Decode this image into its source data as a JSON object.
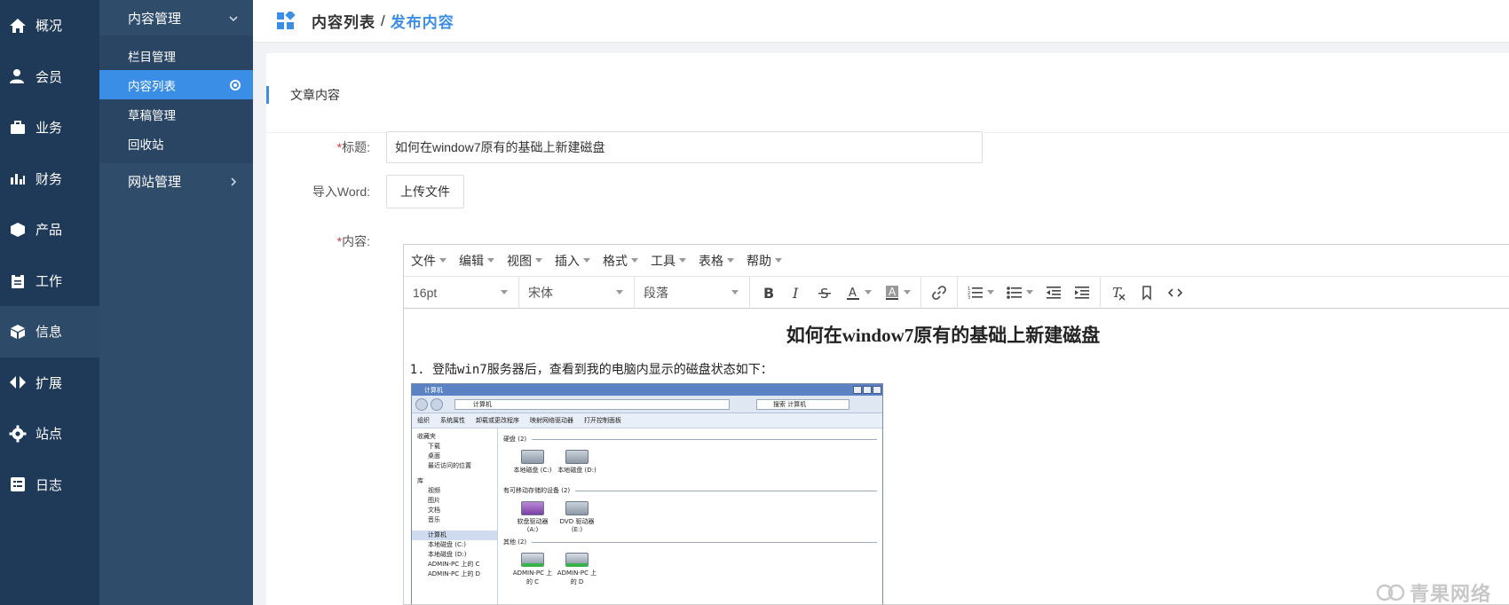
{
  "nav_main": [
    {
      "label": "概况",
      "icon": "home-icon"
    },
    {
      "label": "会员",
      "icon": "user-icon"
    },
    {
      "label": "业务",
      "icon": "briefcase-icon"
    },
    {
      "label": "财务",
      "icon": "bar-chart-icon"
    },
    {
      "label": "产品",
      "icon": "package-icon"
    },
    {
      "label": "工作",
      "icon": "clipboard-icon"
    },
    {
      "label": "信息",
      "icon": "cube-icon",
      "active": true
    },
    {
      "label": "扩展",
      "icon": "code-arrows-icon"
    },
    {
      "label": "站点",
      "icon": "gear-icon"
    },
    {
      "label": "日志",
      "icon": "log-icon"
    }
  ],
  "nav_sub": {
    "group1": "内容管理",
    "items": [
      "栏目管理",
      "内容列表",
      "草稿管理",
      "回收站"
    ],
    "active_item": "内容列表",
    "group2": "网站管理"
  },
  "header": {
    "crumb1": "内容列表",
    "separator": "/",
    "crumb2": "发布内容"
  },
  "card": {
    "title": "文章内容"
  },
  "form": {
    "required_mark": "*",
    "title_label": "标题:",
    "title_value": "如何在window7原有的基础上新建磁盘",
    "import_label": "导入Word:",
    "upload_button": "上传文件",
    "content_label": "内容:"
  },
  "editor": {
    "menus": [
      "文件",
      "编辑",
      "视图",
      "插入",
      "格式",
      "工具",
      "表格",
      "帮助"
    ],
    "font_size": "16pt",
    "font_family": "宋体",
    "block_format": "段落",
    "heading": "如何在window7原有的基础上新建磁盘",
    "list_item_1": "登陆win7服务器后，查看到我的电脑内显示的磁盘状态如下："
  },
  "screenshot": {
    "window_title": "计算机",
    "address": "计算机",
    "search": "搜索 计算机",
    "commands": [
      "组织",
      "系统属性",
      "卸载或更改程序",
      "映射网络驱动器",
      "打开控制面板"
    ],
    "sidebar": [
      "收藏夹",
      "下载",
      "桌面",
      "最近访问的位置",
      "库",
      "视频",
      "图片",
      "文档",
      "音乐",
      "计算机",
      "本地磁盘 (C:)",
      "本地磁盘 (D:)",
      "ADMIN-PC 上的 C",
      "ADMIN-PC 上的 D"
    ],
    "section_hdd": "硬盘 (2)",
    "section_removable": "有可移动存储的设备 (2)",
    "section_other": "其他 (2)",
    "drive_c": "本地磁盘 (C:)",
    "drive_d": "本地磁盘 (D:)",
    "drive_a": "软盘驱动器 (A:)",
    "drive_e": "DVD 驱动器 (E:)",
    "drive_net_c": "ADMIN-PC 上的 C",
    "drive_net_d": "ADMIN-PC 上的 D"
  },
  "watermark": "青果网络",
  "colors": {
    "nav_main_bg": "#1f3a58",
    "nav_sub_bg": "#2f4c6b",
    "accent": "#3a8ee6",
    "required": "#e34444"
  }
}
